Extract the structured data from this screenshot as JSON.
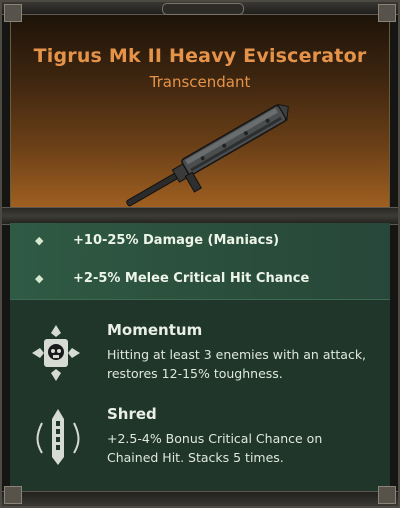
{
  "item": {
    "name": "Tigrus Mk II Heavy Eviscerator",
    "rarity": "Transcendant"
  },
  "stats": [
    {
      "text": "+10-25% Damage (Maniacs)"
    },
    {
      "text": "+2-5% Melee Critical Hit Chance"
    }
  ],
  "perks": [
    {
      "name": "Momentum",
      "description": "Hitting at least 3 enemies with an attack, restores 12-15% toughness.",
      "icon": "skull-icon"
    },
    {
      "name": "Shred",
      "description": "+2.5-4% Bonus Critical Chance on Chained Hit. Stacks 5 times.",
      "icon": "chainblade-icon"
    }
  ],
  "colors": {
    "title": "#e6934a",
    "panel": "#21362b",
    "stat_row": "#2f5a44"
  }
}
